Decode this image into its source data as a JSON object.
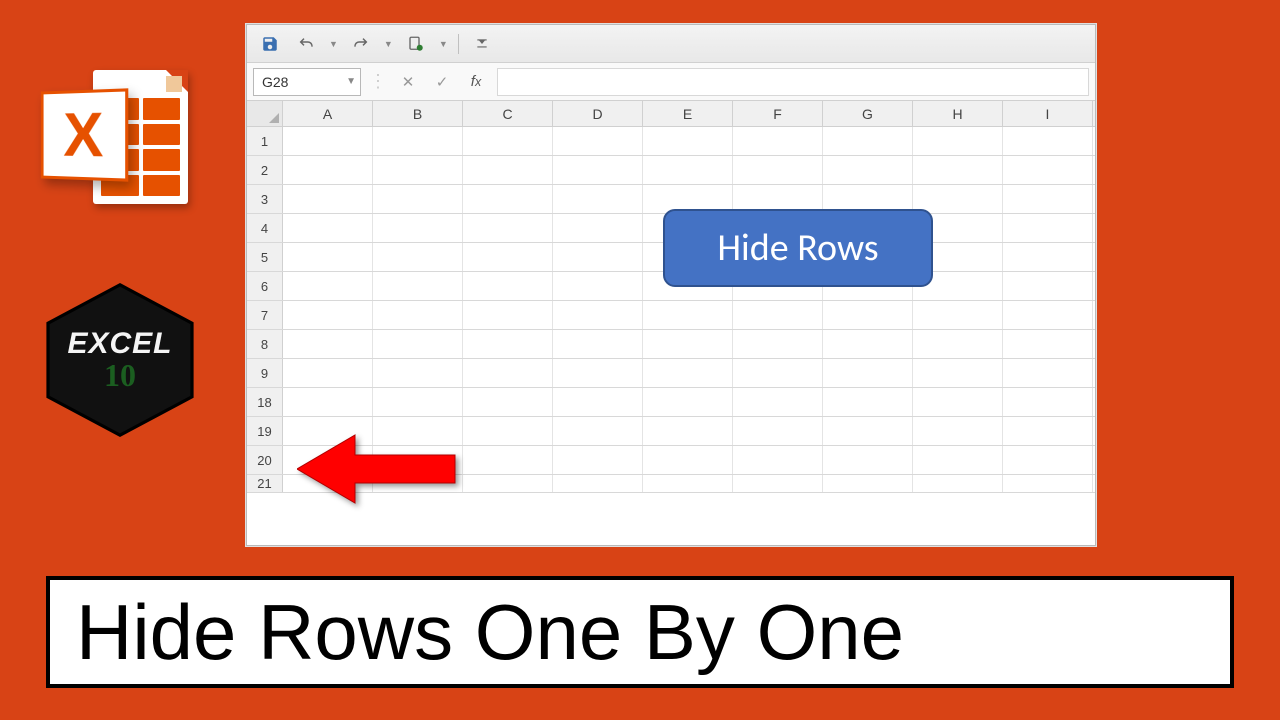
{
  "left_panel": {
    "excel_x": "X",
    "badge_line1": "EXCEL",
    "badge_line2": "10"
  },
  "excel": {
    "name_box": "G28",
    "columns": [
      "A",
      "B",
      "C",
      "D",
      "E",
      "F",
      "G",
      "H",
      "I"
    ],
    "rows": [
      "1",
      "2",
      "3",
      "4",
      "5",
      "6",
      "7",
      "8",
      "9",
      "18",
      "19",
      "20",
      "21"
    ],
    "callout_label": "Hide Rows"
  },
  "caption": "Hide Rows One By One"
}
